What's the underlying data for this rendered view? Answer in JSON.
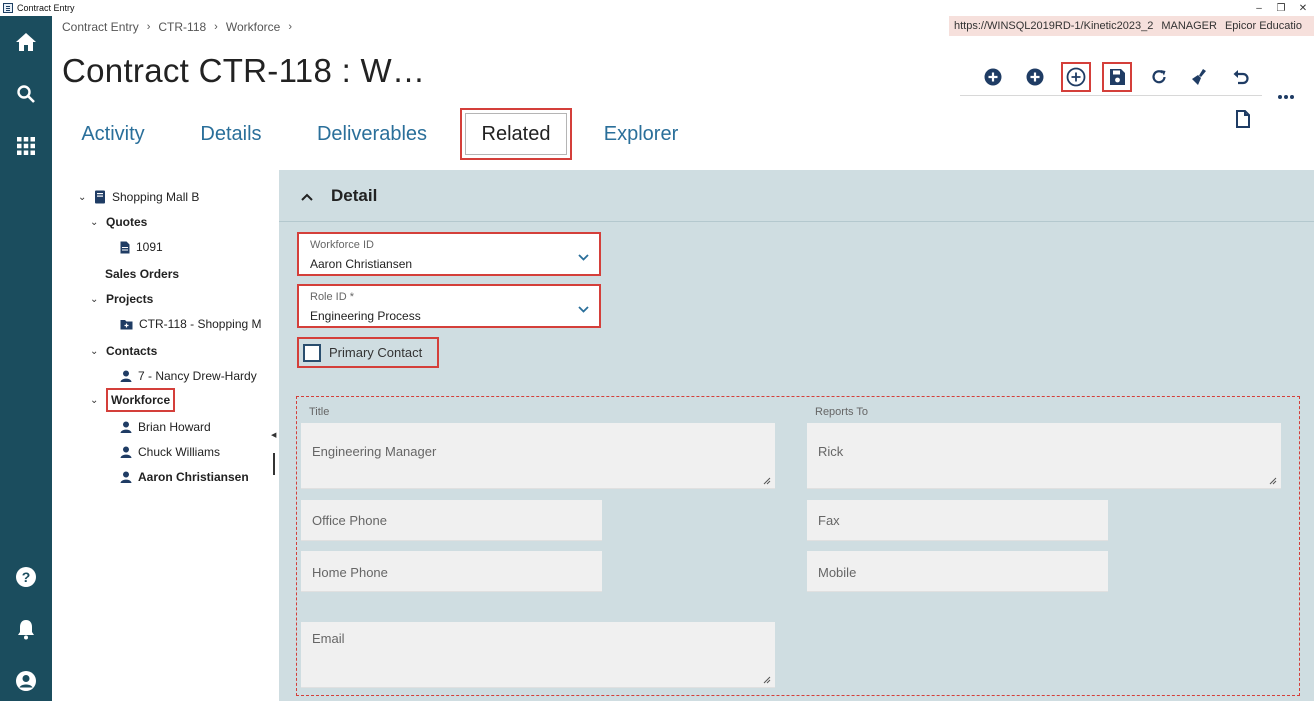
{
  "window": {
    "title": "Contract Entry",
    "controls": [
      "–",
      "❐",
      "✕"
    ]
  },
  "nav_rail": {
    "icons": [
      "home-icon",
      "search-icon",
      "apps-grid-icon",
      "help-icon",
      "bell-icon",
      "user-icon"
    ]
  },
  "breadcrumb": {
    "items": [
      "Contract Entry",
      "CTR-118",
      "Workforce"
    ],
    "separator": "›"
  },
  "header_info": {
    "url": "https://WINSQL2019RD-1/Kinetic2023_2",
    "user": "MANAGER",
    "company": "Epicor Educatio"
  },
  "page": {
    "title": "Contract CTR-118 : W…"
  },
  "toolbar": {
    "buttons": [
      "add-icon",
      "add-icon",
      "add-new-icon",
      "save-icon",
      "refresh-icon",
      "clear-icon",
      "undo-icon"
    ],
    "more": "more-icon",
    "extra": "document-icon"
  },
  "tabs": [
    {
      "label": "Activity",
      "active": false
    },
    {
      "label": "Details",
      "active": false
    },
    {
      "label": "Deliverables",
      "active": false
    },
    {
      "label": "Related",
      "active": true
    },
    {
      "label": "Explorer",
      "active": false
    }
  ],
  "tree": {
    "root": "Shopping Mall B",
    "quotes_label": "Quotes",
    "quote_item": "1091",
    "sales_orders_label": "Sales Orders",
    "projects_label": "Projects",
    "project_item": "CTR-118 - Shopping M",
    "contacts_label": "Contacts",
    "contact_item": "7 - Nancy Drew-Hardy",
    "workforce_label": "Workforce",
    "workforce_items": [
      "Brian Howard",
      "Chuck Williams",
      "Aaron Christiansen"
    ]
  },
  "detail": {
    "header": "Detail",
    "workforce_id": {
      "label": "Workforce ID",
      "value": "Aaron Christiansen"
    },
    "role_id": {
      "label": "Role ID *",
      "value": "Engineering Process"
    },
    "primary_contact": {
      "label": "Primary Contact",
      "checked": false
    },
    "contact": {
      "title_label": "Title",
      "title_value": "Engineering Manager",
      "reports_to_label": "Reports To",
      "reports_to_value": "Rick",
      "office_phone": "Office Phone",
      "fax": "Fax",
      "home_phone": "Home Phone",
      "mobile": "Mobile",
      "email": "Email"
    }
  },
  "colors": {
    "rail": "#1b4d5e",
    "accent_blue": "#2a6f9a",
    "icon_navy": "#1f3c64",
    "highlight_red": "#d43f3a",
    "detail_bg": "#cfdde1"
  }
}
